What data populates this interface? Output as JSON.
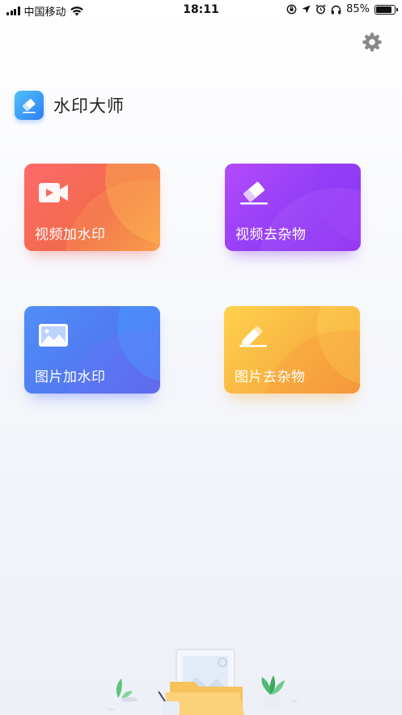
{
  "status_bar": {
    "carrier": "中国移动",
    "time": "18:11",
    "battery_percent": "85%",
    "battery_level": 0.85
  },
  "header": {
    "app_title": "水印大师",
    "settings_icon": "gear-icon"
  },
  "cards": [
    {
      "label": "视频加水印",
      "icon": "video-camera-icon",
      "color": "#f06a4a"
    },
    {
      "label": "视频去杂物",
      "icon": "eraser-icon",
      "color": "#8e3cf6"
    },
    {
      "label": "图片加水印",
      "icon": "image-icon",
      "color": "#5277f0"
    },
    {
      "label": "图片去杂物",
      "icon": "pencil-icon",
      "color": "#f9b642"
    }
  ]
}
